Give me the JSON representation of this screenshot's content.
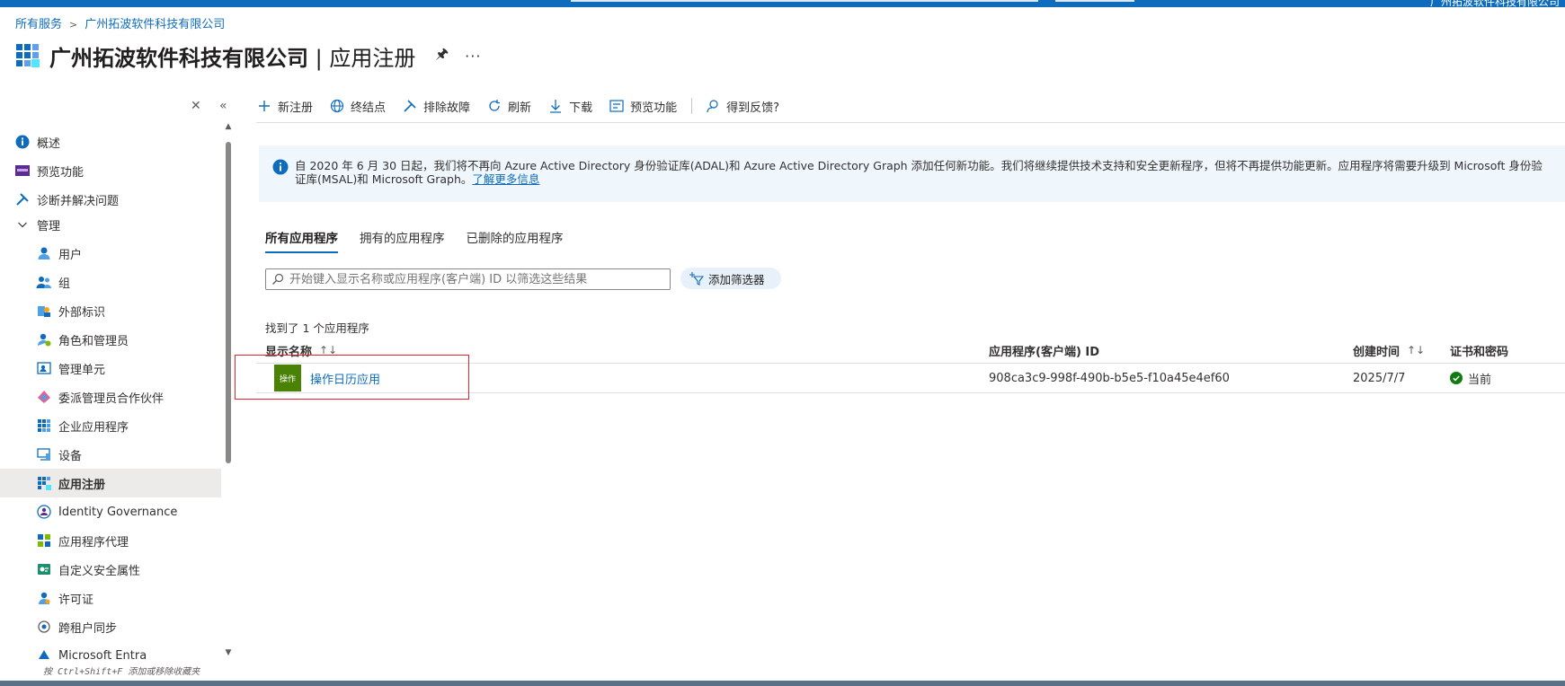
{
  "topbar": {
    "user": "广州拓波软件科技有限公司"
  },
  "breadcrumb": {
    "root": "所有服务",
    "current": "广州拓波软件科技有限公司"
  },
  "header": {
    "org": "广州拓波软件科技有限公司",
    "separator": " | ",
    "page": "应用注册",
    "more": "···"
  },
  "sidebar": {
    "items": [
      {
        "label": "概述",
        "icon": "info-icon"
      },
      {
        "label": "预览功能",
        "icon": "preview-icon"
      },
      {
        "label": "诊断并解决问题",
        "icon": "wrench-icon"
      },
      {
        "label": "管理",
        "icon": "chevron-down-icon"
      },
      {
        "label": "用户",
        "icon": "user-icon"
      },
      {
        "label": "组",
        "icon": "group-icon"
      },
      {
        "label": "外部标识",
        "icon": "external-identity-icon"
      },
      {
        "label": "角色和管理员",
        "icon": "role-icon"
      },
      {
        "label": "管理单元",
        "icon": "admin-unit-icon"
      },
      {
        "label": "委派管理员合作伙伴",
        "icon": "partner-icon"
      },
      {
        "label": "企业应用程序",
        "icon": "enterprise-apps-icon"
      },
      {
        "label": "设备",
        "icon": "device-icon"
      },
      {
        "label": "应用注册",
        "icon": "app-registrations-icon"
      },
      {
        "label": "Identity Governance",
        "icon": "identity-governance-icon"
      },
      {
        "label": "应用程序代理",
        "icon": "app-proxy-icon"
      },
      {
        "label": "自定义安全属性",
        "icon": "custom-security-icon"
      },
      {
        "label": "许可证",
        "icon": "license-icon"
      },
      {
        "label": "跨租户同步",
        "icon": "sync-icon"
      },
      {
        "label": "Microsoft Entra",
        "icon": "entra-icon"
      }
    ],
    "hint": "按 Ctrl+Shift+F 添加或移除收藏夹"
  },
  "toolbar": {
    "new": "新注册",
    "endpoints": "终结点",
    "troubleshoot": "排除故障",
    "refresh": "刷新",
    "download": "下载",
    "preview": "预览功能",
    "feedback": "得到反馈?"
  },
  "banner": {
    "text": "自 2020 年 6 月 30 日起，我们将不再向 Azure Active Directory 身份验证库(ADAL)和 Azure Active Directory Graph 添加任何新功能。我们将继续提供技术支持和安全更新程序，但将不再提供功能更新。应用程序将需要升级到 Microsoft 身份验证库(MSAL)和 Microsoft Graph。",
    "link": "了解更多信息"
  },
  "tabs": [
    "所有应用程序",
    "拥有的应用程序",
    "已删除的应用程序"
  ],
  "search": {
    "placeholder": "开始键入显示名称或应用程序(客户端) ID 以筛选这些结果"
  },
  "filter": {
    "label": "添加筛选器"
  },
  "results": {
    "count_text": "找到了 1 个应用程序"
  },
  "table": {
    "columns": [
      "显示名称",
      "应用程序(客户端) ID",
      "创建时间",
      "证书和密码"
    ],
    "sort_arrow_name": "↑↓",
    "sort_arrow_created": "↑↓",
    "rows": [
      {
        "icon_text": "操作",
        "name": "操作日历应用",
        "client_id": "908ca3c9-998f-490b-b5e5-f10a45e4ef60",
        "created": "2025/7/7",
        "cert_status": "当前"
      }
    ]
  },
  "colors": {
    "accent": "#0f6cbd",
    "app_icon": "#498205",
    "highlight": "#e0242a",
    "ok": "#107c10"
  }
}
